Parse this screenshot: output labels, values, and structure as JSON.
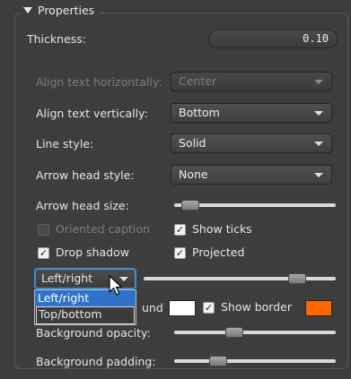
{
  "group": {
    "title": "Properties"
  },
  "thickness": {
    "label": "Thickness:",
    "value": "0.10"
  },
  "rows": {
    "align_h": {
      "label": "Align text horizontally:",
      "value": "Center"
    },
    "align_v": {
      "label": "Align text vertically:",
      "value": "Bottom"
    },
    "line_style": {
      "label": "Line style:",
      "value": "Solid"
    },
    "arrow_style": {
      "label": "Arrow head style:",
      "value": "None"
    },
    "arrow_size": {
      "label": "Arrow head size:",
      "level": 0.1
    }
  },
  "checks": {
    "oriented_caption": {
      "label": "Oriented caption",
      "checked": false
    },
    "show_ticks": {
      "label": "Show ticks",
      "checked": true
    },
    "drop_shadow": {
      "label": "Drop shadow",
      "checked": true
    },
    "projected": {
      "label": "Projected",
      "checked": true
    },
    "show_border": {
      "label": "Show border",
      "checked": true
    }
  },
  "layout_combo": {
    "value": "Left/right",
    "options": [
      "Left/right",
      "Top/bottom"
    ],
    "level": 0.8
  },
  "background": {
    "label_tail": "und",
    "color": "#ffffff",
    "border_color": "#ff6600",
    "opacity_label": "Background opacity:",
    "opacity_level": 0.37,
    "padding_label": "Background padding:",
    "padding_level": 0.27
  },
  "colors": {
    "accent": "#3b8fd8",
    "selection": "#2f73c9"
  }
}
